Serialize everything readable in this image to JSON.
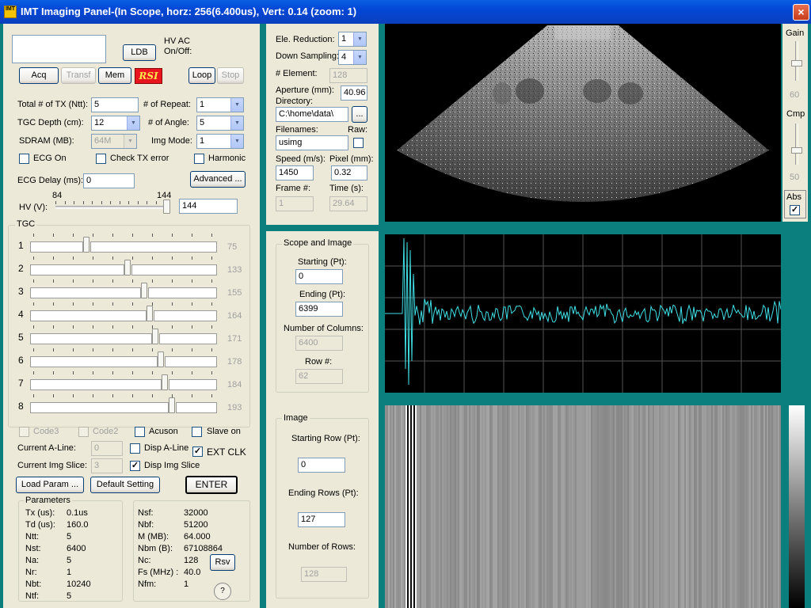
{
  "window": {
    "title": "IMT Imaging Panel-(In Scope, horz: 256(6.400us), Vert: 0.14 (zoom: 1)",
    "icon_text": "IMT",
    "close_glyph": "×"
  },
  "left": {
    "ldb": "LDB",
    "hv_ac": "HV AC",
    "on_off": "On/Off:",
    "buttons": {
      "acq": "Acq",
      "transf": "Transf",
      "mem": "Mem",
      "logo": "RSI",
      "loop": "Loop",
      "stop": "Stop"
    },
    "total_tx_label": "Total # of TX (Ntt):",
    "total_tx": "5",
    "num_repeat_label": "# of Repeat:",
    "num_repeat": "1",
    "tgc_depth_label": "TGC Depth (cm):",
    "tgc_depth": "12",
    "num_angle_label": "# of Angle:",
    "num_angle": "5",
    "sdram_label": "SDRAM (MB):",
    "sdram": "64M",
    "img_mode_label": "Img Mode:",
    "img_mode": "1",
    "ecg_on": "ECG On",
    "check_tx": "Check TX error",
    "harmonic": "Harmonic",
    "ecg_delay_label": "ECG Delay (ms):",
    "ecg_delay": "0",
    "advanced": "Advanced ...",
    "hv_min": "84",
    "hv_max": "144",
    "hv_label": "HV (V):",
    "hv_value": "144",
    "hv_level": 1.0,
    "tgc_title": "TGC",
    "tgc": [
      {
        "idx": "1",
        "value": "75",
        "level": 0.3
      },
      {
        "idx": "2",
        "value": "133",
        "level": 0.52
      },
      {
        "idx": "3",
        "value": "155",
        "level": 0.61
      },
      {
        "idx": "4",
        "value": "164",
        "level": 0.64
      },
      {
        "idx": "5",
        "value": "171",
        "level": 0.67
      },
      {
        "idx": "6",
        "value": "178",
        "level": 0.7
      },
      {
        "idx": "7",
        "value": "184",
        "level": 0.72
      },
      {
        "idx": "8",
        "value": "193",
        "level": 0.76
      }
    ],
    "code3": "Code3",
    "code2": "Code2",
    "acuson": "Acuson",
    "slave_on": "Slave on",
    "current_aline_label": "Current A-Line:",
    "current_aline": "0",
    "disp_aline": "Disp A-Line",
    "ext_clk": "EXT CLK",
    "current_img_label": "Current Img Slice:",
    "current_img": "3",
    "disp_img": "Disp Img Slice",
    "load_param": "Load Param ...",
    "default_setting": "Default Setting",
    "enter": "ENTER",
    "params_title": "Parameters",
    "params_left": [
      {
        "k": "Tx (us):",
        "v": "0.1us"
      },
      {
        "k": "Td (us):",
        "v": "160.0"
      },
      {
        "k": "Ntt:",
        "v": "5"
      },
      {
        "k": "Nst:",
        "v": "6400"
      },
      {
        "k": "Na:",
        "v": "5"
      },
      {
        "k": "Nr:",
        "v": "1"
      },
      {
        "k": "Nbt:",
        "v": "10240"
      },
      {
        "k": "Ntf:",
        "v": "5"
      }
    ],
    "params_right": [
      {
        "k": "Nsf:",
        "v": "32000"
      },
      {
        "k": "Nbf:",
        "v": "51200"
      },
      {
        "k": "M (MB):",
        "v": "64.000"
      },
      {
        "k": "Nbm (B):",
        "v": "67108864"
      },
      {
        "k": "Nc:",
        "v": "128"
      },
      {
        "k": "Fs (MHz) :",
        "v": "40.0"
      },
      {
        "k": "Nfm:",
        "v": "1"
      }
    ],
    "rsv": "Rsv",
    "help": "?"
  },
  "middle": {
    "ele_reduction_label": "Ele. Reduction:",
    "ele_reduction": "1",
    "down_sampling_label": "Down Sampling:",
    "down_sampling": "4",
    "element_label": "# Element:",
    "element": "128",
    "aperture_label": "Aperture (mm):",
    "aperture": "40.96",
    "directory_label": "Directory:",
    "directory": "C:\\home\\data\\",
    "browse": "...",
    "filenames_label": "Filenames:",
    "raw_label": "Raw:",
    "filename": "usimg",
    "speed_label": "Speed (m/s):",
    "speed": "1450",
    "pixel_label": "Pixel (mm):",
    "pixel": "0.32",
    "frame_label": "Frame #:",
    "frame": "1",
    "time_label": "Time (s):",
    "time": "29.64"
  },
  "scope": {
    "title": "Scope and Image",
    "starting_label": "Starting (Pt):",
    "starting": "0",
    "ending_label": "Ending (Pt):",
    "ending": "6399",
    "columns_label": "Number of Columns:",
    "columns": "6400",
    "row_label": "Row #:",
    "row": "62"
  },
  "image": {
    "title": "Image",
    "start_row_label": "Starting Row (Pt):",
    "start_row": "0",
    "end_rows_label": "Ending Rows (Pt):",
    "end_rows": "127",
    "num_rows_label": "Number of Rows:",
    "num_rows": "128"
  },
  "gain_panel": {
    "gain_label": "Gain",
    "gain_value": "60",
    "cmp_label": "Cmp",
    "cmp_value": "50",
    "abs_label": "Abs"
  },
  "colors": {
    "trace": "#3fe0e6",
    "background": "#0b7e7e",
    "panel": "#ece9d8"
  }
}
